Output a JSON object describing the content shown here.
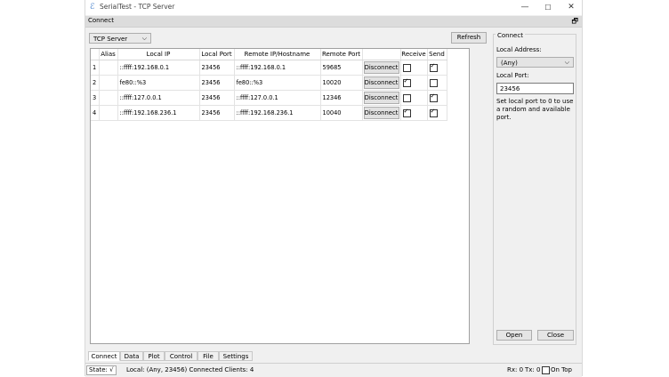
{
  "window": {
    "title": "SerialTest - TCP Server",
    "minimize": "—",
    "maximize": "☐",
    "close": "✕"
  },
  "dock": {
    "title": "Connect",
    "float_icon": "🗗"
  },
  "toolbar": {
    "mode": "TCP Server",
    "refresh_label": "Refresh"
  },
  "table": {
    "headers": [
      "Alias",
      "Local IP",
      "Local Port",
      "Remote IP/Hostname",
      "Remote Port",
      "",
      "Receive",
      "Send"
    ],
    "rows": [
      {
        "num": "1",
        "local_ip": "::ffff:192.168.0.1",
        "local_port": "23456",
        "remote_ip": "::ffff:192.168.0.1",
        "remote_port": "59685",
        "action": "Disconnect",
        "receive": false,
        "send": true
      },
      {
        "num": "2",
        "local_ip": "fe80::%3",
        "local_port": "23456",
        "remote_ip": "fe80::%3",
        "remote_port": "10020",
        "action": "Disconnect",
        "receive": true,
        "send": false
      },
      {
        "num": "3",
        "local_ip": "::ffff:127.0.0.1",
        "local_port": "23456",
        "remote_ip": "::ffff:127.0.0.1",
        "remote_port": "12346",
        "action": "Disconnect",
        "receive": false,
        "send": true
      },
      {
        "num": "4",
        "local_ip": "::ffff:192.168.236.1",
        "local_port": "23456",
        "remote_ip": "::ffff:192.168.236.1",
        "remote_port": "10040",
        "action": "Disconnect",
        "receive": true,
        "send": true
      }
    ]
  },
  "panel": {
    "title": "Connect",
    "local_address_label": "Local Address:",
    "local_address_value": "(Any)",
    "local_port_label": "Local Port:",
    "local_port_value": "23456",
    "hint": "Set local port to 0 to use a random and available port.",
    "open_label": "Open",
    "close_label": "Close"
  },
  "tabs": [
    "Connect",
    "Data",
    "Plot",
    "Control",
    "File",
    "Settings"
  ],
  "status": {
    "state": "State: √",
    "info": "Local: (Any, 23456) Connected Clients: 4",
    "rx": "Rx: 0",
    "tx": "Tx: 0",
    "on_top": "On Top"
  }
}
